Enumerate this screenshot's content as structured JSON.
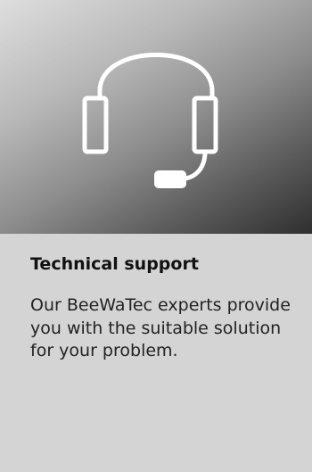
{
  "card": {
    "icon": "headset-icon",
    "title": "Technical support",
    "description": "Our BeeWaTec experts provide you with the suitable solution for your problem."
  },
  "colors": {
    "card_background": "#d4d4d4",
    "gradient_light": "#dedede",
    "gradient_dark": "#2f2f2f",
    "icon_stroke": "#ffffff"
  }
}
